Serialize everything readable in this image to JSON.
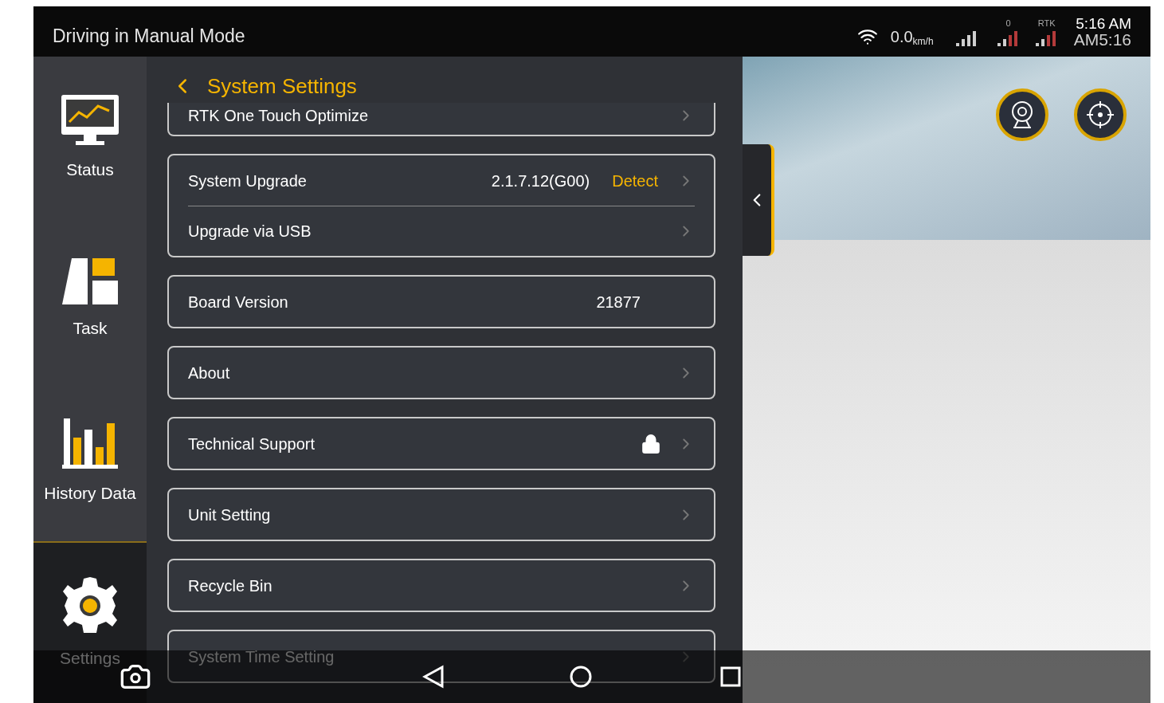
{
  "status_bar": {
    "title": "Driving in Manual Mode",
    "speed": "0.0",
    "speed_unit": "km/h",
    "satellites": "0",
    "rtk": "RTK",
    "time": "5:16 AM",
    "time_overlay": "AM5:16"
  },
  "sidebar": {
    "items": [
      {
        "label": "Status",
        "kind": "monitor",
        "selected": false
      },
      {
        "label": "Task",
        "kind": "task",
        "selected": false
      },
      {
        "label": "History Data",
        "kind": "chart",
        "selected": false
      },
      {
        "label": "Settings",
        "kind": "gear",
        "selected": true
      }
    ]
  },
  "settings": {
    "title": "System Settings",
    "groups": [
      {
        "rows": [
          {
            "label": "RTK One Touch Optimize",
            "chevron": true,
            "locked": false
          }
        ]
      },
      {
        "rows": [
          {
            "label": "System Upgrade",
            "value": "2.1.7.12(G00)",
            "action": "Detect",
            "chevron": true,
            "locked": false
          },
          {
            "label": "Upgrade via USB",
            "chevron": true,
            "locked": false
          }
        ]
      },
      {
        "rows": [
          {
            "label": "Board Version",
            "value": "21877",
            "chevron": false,
            "locked": false
          }
        ]
      },
      {
        "rows": [
          {
            "label": "About",
            "chevron": true,
            "locked": false
          }
        ]
      },
      {
        "rows": [
          {
            "label": "Technical Support",
            "chevron": true,
            "locked": true
          }
        ]
      },
      {
        "rows": [
          {
            "label": "Unit Setting",
            "chevron": true,
            "locked": false
          }
        ]
      },
      {
        "rows": [
          {
            "label": "Recycle Bin",
            "chevron": true,
            "locked": false
          }
        ]
      },
      {
        "rows": [
          {
            "label": "System Time Setting",
            "chevron": true,
            "locked": false
          }
        ]
      }
    ]
  }
}
